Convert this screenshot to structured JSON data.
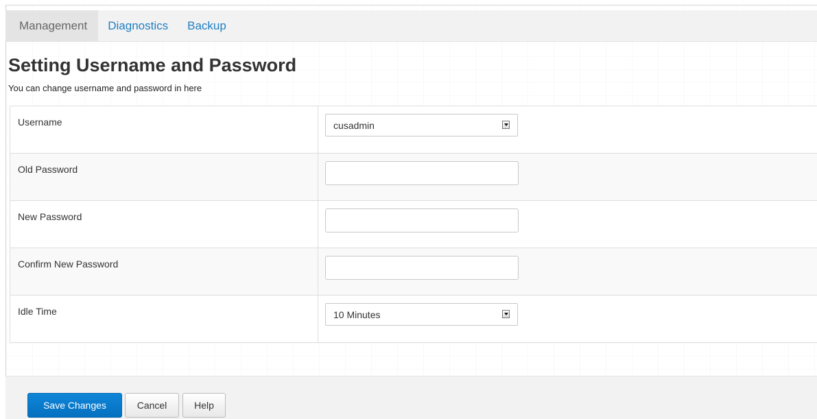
{
  "tabs": [
    {
      "label": "Management",
      "active": true
    },
    {
      "label": "Diagnostics",
      "active": false
    },
    {
      "label": "Backup",
      "active": false
    }
  ],
  "page": {
    "title": "Setting Username and Password",
    "subtitle": "You can change username and password in here"
  },
  "form": {
    "username": {
      "label": "Username",
      "value": "cusadmin"
    },
    "old_password": {
      "label": "Old Password",
      "value": ""
    },
    "new_password": {
      "label": "New Password",
      "value": ""
    },
    "confirm_password": {
      "label": "Confirm New Password",
      "value": ""
    },
    "idle_time": {
      "label": "Idle Time",
      "value": "10 Minutes"
    }
  },
  "footer": {
    "save_label": "Save Changes",
    "cancel_label": "Cancel",
    "help_label": "Help"
  },
  "colors": {
    "accent": "#1f7fc4",
    "primary_button": "#0a7bcc"
  }
}
